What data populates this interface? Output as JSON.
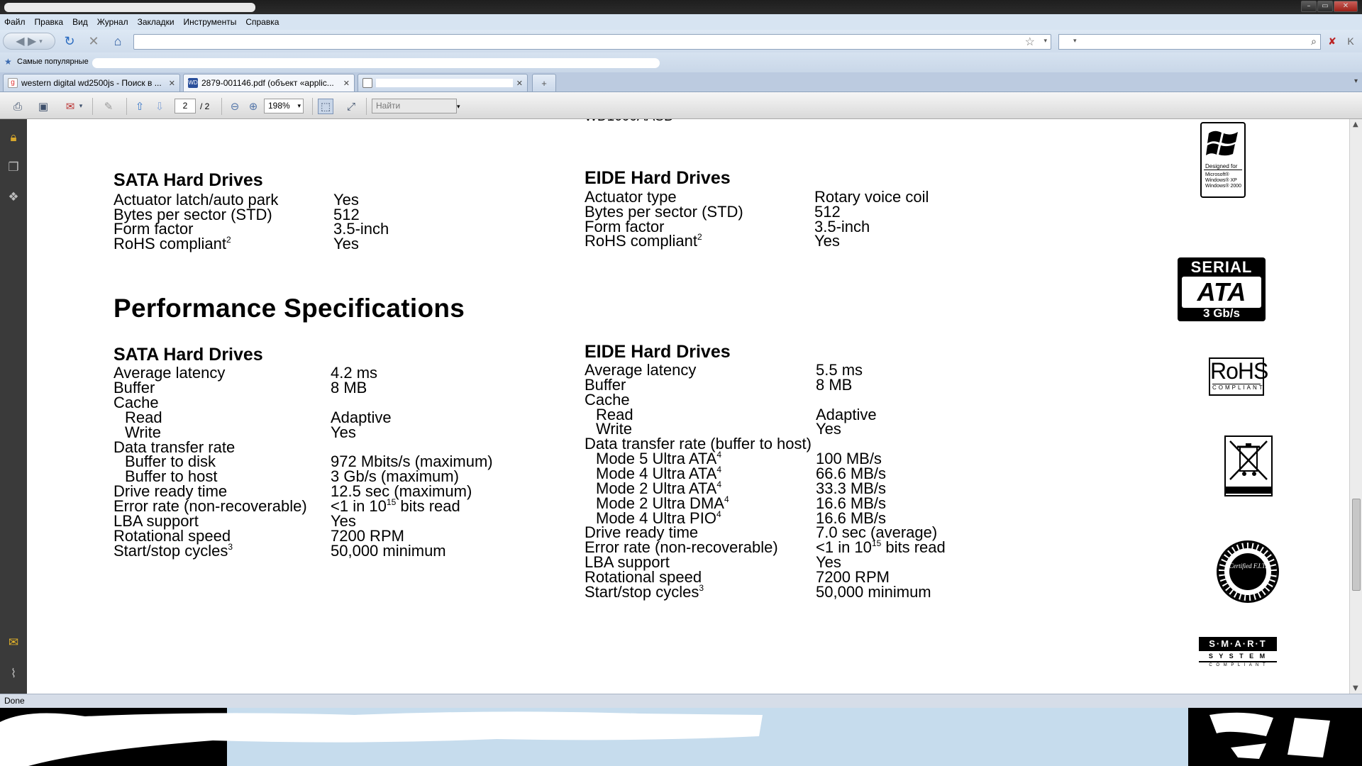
{
  "menu": [
    "Файл",
    "Правка",
    "Вид",
    "Журнал",
    "Закладки",
    "Инструменты",
    "Справка"
  ],
  "bookmarks": {
    "label": "Самые популярные"
  },
  "tabs": [
    {
      "label": "western digital wd2500js - Поиск в ...",
      "active": false
    },
    {
      "label": "2879-001146.pdf (объект «applic...",
      "active": true
    },
    {
      "label": "",
      "active": false
    }
  ],
  "pdf_toolbar": {
    "page_current": "2",
    "page_total": "/ 2",
    "zoom": "198%",
    "find_placeholder": "Найти"
  },
  "document": {
    "cut_top_text": "WD1600AASB",
    "left": {
      "sata1": {
        "heading": "SATA Hard Drives",
        "rows": [
          {
            "label": "Actuator latch/auto park",
            "value": "Yes"
          },
          {
            "label": "Bytes per sector (STD)",
            "value": "512"
          },
          {
            "label": "Form factor",
            "value": "3.5-inch"
          },
          {
            "label": "RoHS compliant",
            "sup": "2",
            "value": "Yes"
          }
        ]
      },
      "performance_title": "Performance Specifications",
      "sata2": {
        "heading": "SATA Hard Drives",
        "rows": [
          {
            "label": "Average latency",
            "value": "4.2 ms"
          },
          {
            "label": "Buffer",
            "value": "8 MB"
          },
          {
            "label": "Cache",
            "value": ""
          },
          {
            "label": "Read",
            "value": "Adaptive",
            "indent": true
          },
          {
            "label": "Write",
            "value": "Yes",
            "indent": true
          },
          {
            "label": "Data transfer rate",
            "value": ""
          },
          {
            "label": "Buffer to disk",
            "value": "972 Mbits/s (maximum)",
            "indent": true
          },
          {
            "label": "Buffer to host",
            "value": "3 Gb/s (maximum)",
            "indent": true
          },
          {
            "label": "Drive ready time",
            "value": "12.5 sec (maximum)"
          },
          {
            "label": "Error rate (non-recoverable)",
            "value": "<1 in 10",
            "value_sup": "15",
            "value_tail": " bits read"
          },
          {
            "label": "LBA support",
            "value": "Yes"
          },
          {
            "label": "Rotational speed",
            "value": "7200 RPM"
          },
          {
            "label": "Start/stop cycles",
            "sup": "3",
            "value": "50,000 minimum"
          }
        ]
      }
    },
    "right": {
      "eide1": {
        "heading": "EIDE Hard Drives",
        "rows": [
          {
            "label": "Actuator type",
            "value": "Rotary voice coil"
          },
          {
            "label": "Bytes per sector (STD)",
            "value": "512"
          },
          {
            "label": "Form factor",
            "value": "3.5-inch"
          },
          {
            "label": "RoHS compliant",
            "sup": "2",
            "value": "Yes"
          }
        ]
      },
      "eide2": {
        "heading": "EIDE Hard Drives",
        "rows": [
          {
            "label": "Average latency",
            "value": "5.5 ms"
          },
          {
            "label": "Buffer",
            "value": "8 MB"
          },
          {
            "label": "Cache",
            "value": ""
          },
          {
            "label": "Read",
            "value": "Adaptive",
            "indent": true
          },
          {
            "label": "Write",
            "value": "Yes",
            "indent": true
          },
          {
            "label": "Data transfer rate (buffer to host)",
            "value": ""
          },
          {
            "label": "Mode 5 Ultra ATA",
            "sup": "4",
            "value": "100 MB/s",
            "indent": true
          },
          {
            "label": "Mode 4 Ultra ATA",
            "sup": "4",
            "value": "66.6 MB/s",
            "indent": true
          },
          {
            "label": "Mode 2 Ultra ATA",
            "sup": "4",
            "value": "33.3 MB/s",
            "indent": true
          },
          {
            "label": "Mode 2 Ultra DMA",
            "sup": "4",
            "value": "16.6 MB/s",
            "indent": true
          },
          {
            "label": "Mode 4 Ultra PIO",
            "sup": "4",
            "value": "16.6 MB/s",
            "indent": true
          },
          {
            "label": "Drive ready time",
            "value": "7.0 sec (average)"
          },
          {
            "label": "Error rate (non-recoverable)",
            "value": "<1 in 10",
            "value_sup": "15",
            "value_tail": " bits read"
          },
          {
            "label": "LBA support",
            "value": "Yes"
          },
          {
            "label": "Rotational speed",
            "value": "7200 RPM"
          },
          {
            "label": "Start/stop cycles",
            "sup": "3",
            "value": "50,000 minimum"
          }
        ]
      }
    },
    "logos": {
      "windows": {
        "designed": "Designed for",
        "lines": "Microsoft® Windows® XP Windows® 2000"
      },
      "sata": {
        "top": "SERIAL",
        "mid": "ATA",
        "bottom": "3 Gb/s"
      },
      "rohs": {
        "big": "RoHS",
        "small": "COMPLIANT"
      },
      "fit": {
        "text": "Certified F.I.T."
      },
      "smart": {
        "top": "S·M·A·R·T",
        "mid": "S Y S T E M",
        "bottom": "C O M P L I A N T"
      }
    }
  },
  "status": {
    "text": "Done"
  },
  "colors": {
    "panel": "#3a3a3a",
    "chrome": "#d7e4f2",
    "taskbar_light": "#c6dced"
  }
}
